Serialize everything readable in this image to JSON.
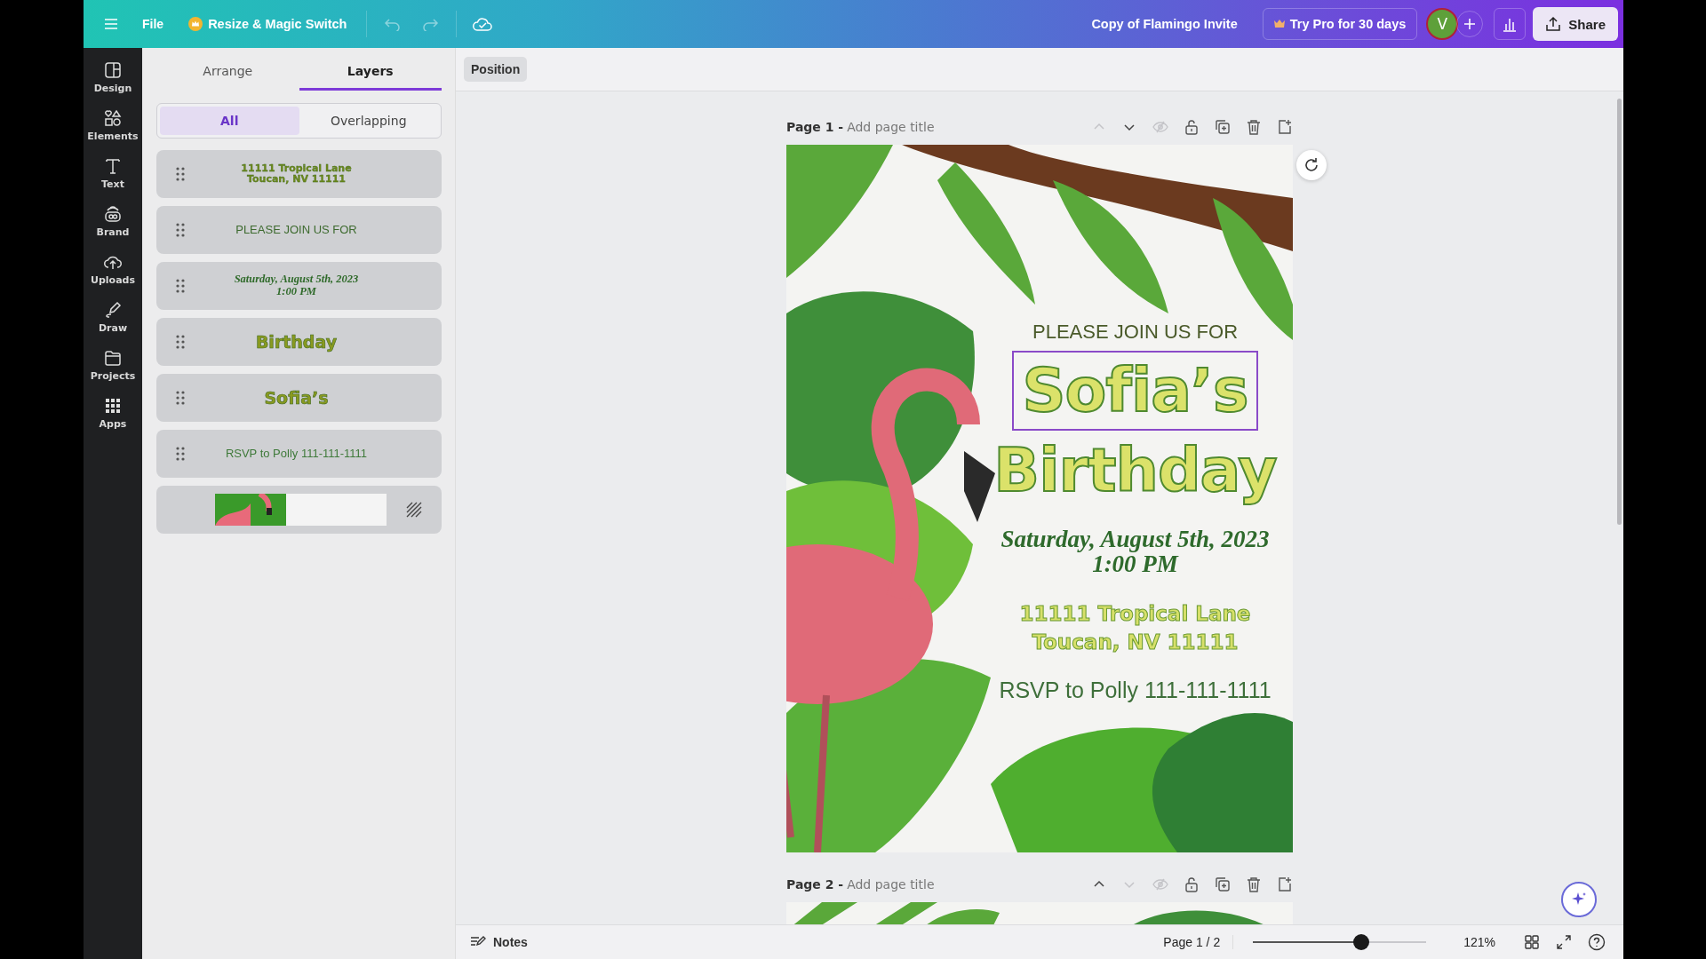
{
  "topbar": {
    "file": "File",
    "resize": "Resize & Magic Switch",
    "title": "Copy of Flamingo Invite",
    "pro": "Try Pro for 30 days",
    "avatar": "V",
    "share": "Share"
  },
  "rail": [
    {
      "label": "Design",
      "kind": "design"
    },
    {
      "label": "Elements",
      "kind": "elements"
    },
    {
      "label": "Text",
      "kind": "text"
    },
    {
      "label": "Brand",
      "kind": "brand"
    },
    {
      "label": "Uploads",
      "kind": "uploads"
    },
    {
      "label": "Draw",
      "kind": "draw"
    },
    {
      "label": "Projects",
      "kind": "projects"
    },
    {
      "label": "Apps",
      "kind": "apps"
    }
  ],
  "panel": {
    "tabs": [
      {
        "label": "Arrange",
        "selected": false
      },
      {
        "label": "Layers",
        "selected": true
      }
    ],
    "filters": [
      {
        "label": "All",
        "selected": true
      },
      {
        "label": "Overlapping",
        "selected": false
      }
    ],
    "layers": [
      {
        "kind": "outlined",
        "lines": [
          "11111 Tropical Lane",
          "Toucan, NV 11111"
        ]
      },
      {
        "kind": "plain",
        "lines": [
          "PLEASE JOIN US FOR"
        ]
      },
      {
        "kind": "script",
        "lines": [
          "Saturday, August 5th, 2023",
          "1:00 PM"
        ]
      },
      {
        "kind": "outlined-large",
        "lines": [
          "Birthday"
        ]
      },
      {
        "kind": "outlined-large",
        "lines": [
          "Sofia’s"
        ]
      },
      {
        "kind": "rsvp",
        "lines": [
          "RSVP to Polly 111-111-1111"
        ]
      },
      {
        "kind": "image"
      }
    ]
  },
  "toolbar": {
    "position": "Position"
  },
  "pages": [
    {
      "label": "Page 1 -",
      "placeholder": "Add page title",
      "can_move_up": false,
      "can_move_down": true
    },
    {
      "label": "Page 2 -",
      "placeholder": "Add page title",
      "can_move_up": true,
      "can_move_down": false
    }
  ],
  "design": {
    "texts": [
      {
        "kind": "plain",
        "lines": [
          "PLEASE JOIN US FOR"
        ],
        "selected": false
      },
      {
        "kind": "title",
        "lines": [
          "Sofia’s"
        ],
        "selected": true
      },
      {
        "kind": "title",
        "lines": [
          "Birthday"
        ],
        "selected": false
      },
      {
        "kind": "script",
        "lines": [
          "Saturday, August 5th, 2023",
          "1:00 PM"
        ],
        "selected": false
      },
      {
        "kind": "outlined",
        "lines": [
          "11111 Tropical Lane",
          "Toucan, NV 11111"
        ],
        "selected": false
      },
      {
        "kind": "rsvp",
        "lines": [
          "RSVP to Polly 111-111-1111"
        ],
        "selected": false
      }
    ]
  },
  "footer": {
    "notes": "Notes",
    "page": "Page 1 / 2",
    "zoom": "121%",
    "level": 0.625
  }
}
